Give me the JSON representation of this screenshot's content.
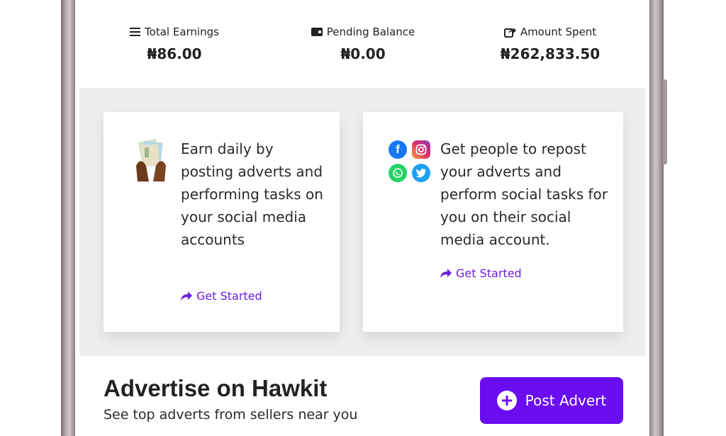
{
  "stats": [
    {
      "label": "Total Earnings",
      "value": "₦86.00",
      "icon": "list-icon"
    },
    {
      "label": "Pending Balance",
      "value": "₦0.00",
      "icon": "wallet-icon"
    },
    {
      "label": "Amount Spent",
      "value": "₦262,833.50",
      "icon": "share-out-icon"
    }
  ],
  "cards": [
    {
      "text": "Earn daily by posting adverts and performing tasks on your social media accounts",
      "link": "Get Started",
      "icon": "money-hands-icon"
    },
    {
      "text": "Get people to repost your adverts and perform social tasks for you on their social media account.",
      "link": "Get Started",
      "icons": [
        "facebook-icon",
        "instagram-icon",
        "whatsapp-icon",
        "twitter-icon"
      ]
    }
  ],
  "advertise": {
    "title": "Advertise on Hawkit",
    "subtitle": "See top adverts from sellers near you",
    "button": "Post Advert"
  },
  "colors": {
    "accent": "#6a0df0",
    "link": "#6a1de0",
    "band": "#eeeeee"
  }
}
